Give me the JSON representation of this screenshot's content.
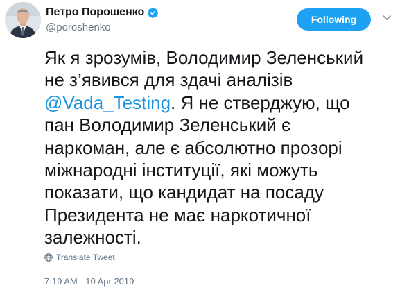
{
  "user": {
    "display_name": "Петро Порошенко",
    "handle": "@poroshenko"
  },
  "follow_button": {
    "label": "Following"
  },
  "tweet": {
    "lines": [
      {
        "text": "Як я зрозумів, Володимир Зеленський"
      },
      {
        "text": "не з’явився для здачі аналізів"
      },
      {
        "mention": "@Vada_Testing",
        "text": ". Я не стверджую, що"
      },
      {
        "text": "пан Володимир Зеленський є"
      },
      {
        "text": "наркоман, але є абсолютно прозорі"
      },
      {
        "text": "міжнародні інституції, які можуть"
      },
      {
        "text": "показати, що кандидат на посаду"
      },
      {
        "text": "Президента не має наркотичної"
      },
      {
        "text": "залежності."
      }
    ]
  },
  "translate": {
    "label": "Translate Tweet"
  },
  "timestamp": "7:19 AM - 10 Apr 2019",
  "colors": {
    "accent": "#1da1f2",
    "mention": "#1b95e0",
    "secondary_text": "#657786",
    "primary_text": "#14171a"
  },
  "icons": {
    "verified": "verified-badge-icon",
    "menu": "chevron-down-icon",
    "translate": "globe-icon"
  }
}
